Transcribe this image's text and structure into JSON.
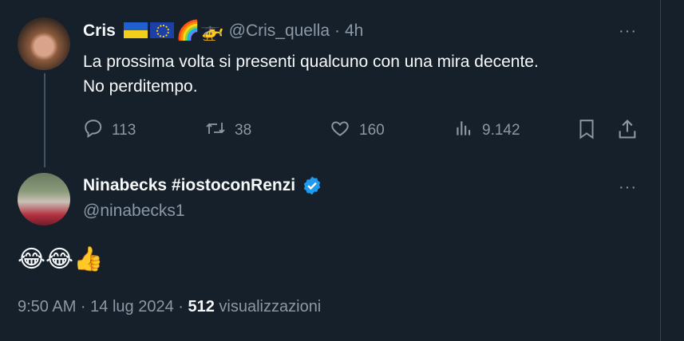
{
  "tweet1": {
    "author_name": "Cris",
    "emoji_suffix": "🌈🚁",
    "handle": "@Cris_quella",
    "separator": "·",
    "time": "4h",
    "text_line1": "La prossima volta si presenti qualcuno con una mira decente.",
    "text_line2": "No perditempo.",
    "more": "···",
    "actions": {
      "replies": "113",
      "retweets": "38",
      "likes": "160",
      "views": "9.142"
    }
  },
  "tweet2": {
    "author_name": "Ninabecks #iostoconRenzi",
    "handle": "@ninabecks1",
    "more": "···",
    "text": "😂😂👍",
    "timestamp": "9:50 AM · 14 lug 2024 ·",
    "views_count": "512",
    "views_label": "visualizzazioni"
  },
  "colors": {
    "background": "#15202b",
    "text": "#f7f9f9",
    "secondary": "#8b98a5",
    "verified": "#1d9bf0"
  }
}
